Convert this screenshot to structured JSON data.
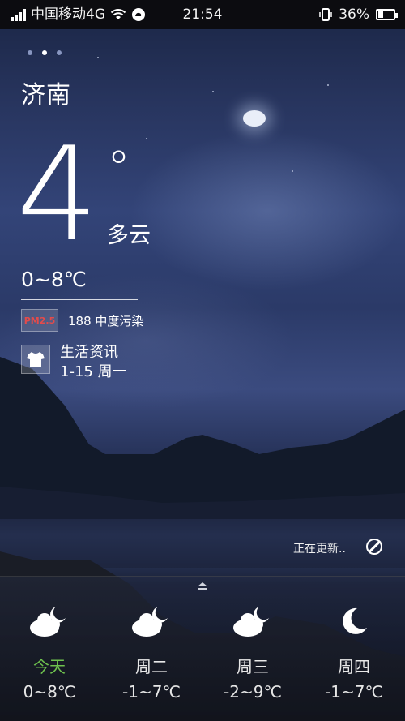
{
  "status_bar": {
    "carrier": "中国移动4G",
    "time": "21:54",
    "battery": "36%",
    "battery_level": 0.36
  },
  "pages": {
    "count": 3,
    "active_index": 1
  },
  "weather": {
    "city": "济南",
    "temperature": "4",
    "degree_symbol": "°",
    "condition": "多云",
    "range": "0~8℃",
    "aqi_badge": "PM2.5",
    "aqi_text": "188  中度污染",
    "life_title": "生活资讯",
    "life_date": "1-15 周一",
    "updating": "正在更新.."
  },
  "forecast": [
    {
      "day": "今天",
      "range": "0~8℃",
      "icon": "cloudy-night-icon",
      "today": true
    },
    {
      "day": "周二",
      "range": "-1~7℃",
      "icon": "cloudy-night-icon",
      "today": false
    },
    {
      "day": "周三",
      "range": "-2~9℃",
      "icon": "cloudy-night-icon",
      "today": false
    },
    {
      "day": "周四",
      "range": "-1~7℃",
      "icon": "clear-night-icon",
      "today": false
    }
  ],
  "colors": {
    "today_accent": "#6ec14e",
    "aqi_red": "#e34b4b"
  }
}
